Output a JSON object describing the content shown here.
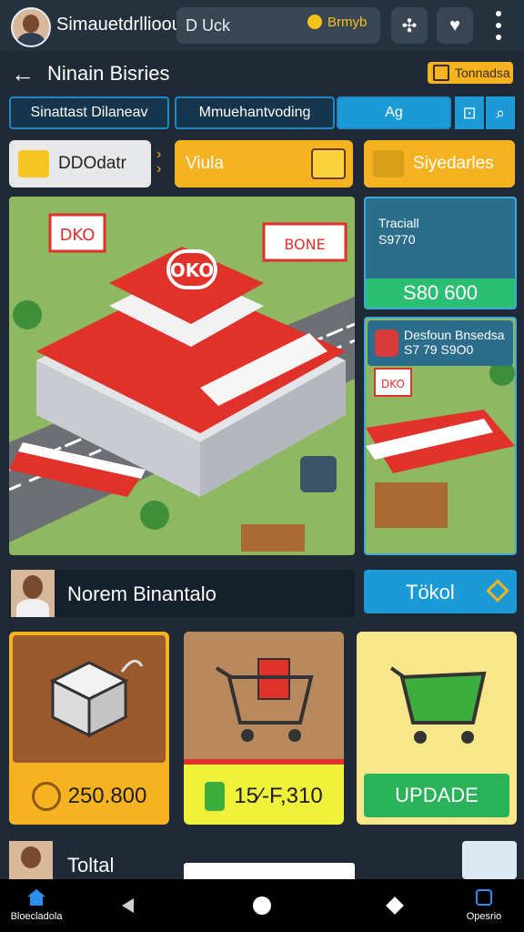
{
  "topbar": {
    "app_name": "Simauetdrllioou",
    "search_text": "D Uck",
    "coin_label": "Brmyb",
    "share_icon": "share-icon",
    "chat_icon": "chat-heart-icon",
    "menu_icon": "more-vertical-icon"
  },
  "header": {
    "back_icon": "arrow-left-icon",
    "title": "Ninain Bisries",
    "tournament_label": "Tonnadsa"
  },
  "tabs": [
    {
      "label": "Sinattast Dilaneav",
      "active": false
    },
    {
      "label": "Mmuehantvoding",
      "active": false
    },
    {
      "label": "Ag",
      "active": true
    }
  ],
  "tools": {
    "bag_icon": "bag-icon",
    "search_icon": "search-icon"
  },
  "categories": [
    {
      "label": "DDOdatr",
      "icon": "basket-icon"
    },
    {
      "label": "Viula",
      "icon": "envelope-icon"
    },
    {
      "label": "Siyedarles",
      "icon": "coins-icon"
    }
  ],
  "scene": {
    "store_sign": "OKO",
    "side_sign_left": "DKO",
    "side_sign_right": "BONE"
  },
  "side_panels": [
    {
      "title": "Traciall",
      "subtitle": "S9770",
      "price": "S80 600"
    },
    {
      "title": "Desfoun",
      "title2": "Bnsedsa",
      "subtitle": "S7 79",
      "subtitle2": "S9O0",
      "sign": "DKO"
    }
  ],
  "player": {
    "name": "Norem Binantalo",
    "action_label": "Tökol"
  },
  "cards": [
    {
      "item": "storage-machine",
      "price": "250.800",
      "price_icon": "coin-icon",
      "accent": "#f5b321"
    },
    {
      "item": "shopping-cart-red",
      "price": "15⁄-F,310",
      "price_icon": "cash-icon",
      "accent": "#f0f13a"
    },
    {
      "item": "shopping-cart-green",
      "button": "UPDADE",
      "accent": "#2bb35c"
    }
  ],
  "footer_row": {
    "label": "Toltal"
  },
  "navbar": [
    {
      "label": "Bloecladola",
      "icon": "home-icon"
    },
    {
      "label": "",
      "icon": "back-triangle-icon"
    },
    {
      "label": "",
      "icon": "home-circle-icon"
    },
    {
      "label": "",
      "icon": "diamond-icon"
    },
    {
      "label": "Opesrio",
      "icon": "profile-icon"
    }
  ]
}
